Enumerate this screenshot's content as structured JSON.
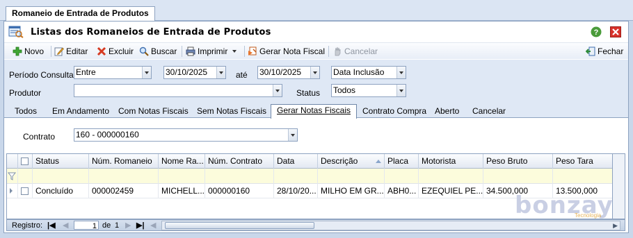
{
  "document_tab": "Romaneio de Entrada de Produtos",
  "window": {
    "title": "Listas dos Romaneios de Entrada de Produtos"
  },
  "toolbar": {
    "novo": "Novo",
    "editar": "Editar",
    "excluir": "Excluir",
    "buscar": "Buscar",
    "imprimir": "Imprimir",
    "gerar_nota": "Gerar Nota Fiscal",
    "cancelar": "Cancelar",
    "fechar": "Fechar"
  },
  "filters": {
    "periodo_label": "Período Consulta",
    "periodo_mode": "Entre",
    "date_from": "30/10/2025",
    "ate_label": "até",
    "date_to": "30/10/2025",
    "date_field": "Data Inclusão",
    "produtor_label": "Produtor",
    "produtor_value": "",
    "status_label": "Status",
    "status_value": "Todos"
  },
  "view_tabs": [
    "Todos",
    "Em Andamento",
    "Com Notas Fiscais",
    "Sem Notas Fiscais",
    "Gerar Notas Fiscais",
    "Contrato Compra",
    "Aberto",
    "Cancelar"
  ],
  "active_view_tab": "Gerar Notas Fiscais",
  "contract": {
    "label": "Contrato",
    "value": "160 - 000000160"
  },
  "grid": {
    "columns": [
      "Status",
      "Núm. Romaneio",
      "Nome Ra...",
      "Núm. Contrato",
      "Data",
      "Descrição",
      "Placa",
      "Motorista",
      "Peso Bruto",
      "Peso Tara"
    ],
    "rows": [
      [
        "Concluído",
        "000002459",
        "MICHELL...",
        "000000160",
        "28/10/20...",
        "MILHO EM GR...",
        "ABH0...",
        "EZEQUIEL  PE...",
        "34.500,000",
        "13.500,000"
      ]
    ]
  },
  "statusbar": {
    "registro_label": "Registro:",
    "current_record": "1",
    "of_label": "de",
    "total": "1"
  },
  "watermark": {
    "text": "bonzay",
    "sub": "Tecnologia"
  },
  "colors": {
    "accent": "#8da2c0",
    "filter_row": "#fcfcdc",
    "form_bg": "#dfe8f5"
  }
}
